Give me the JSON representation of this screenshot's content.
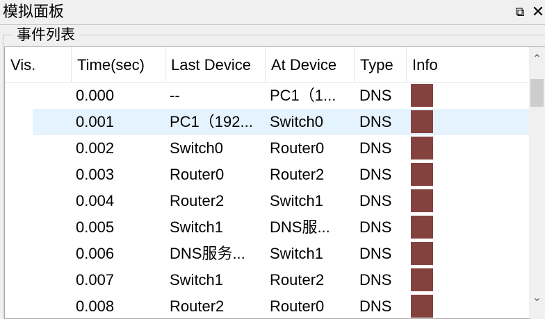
{
  "window": {
    "title": "模拟面板",
    "float_icon": "⧉",
    "close_icon": "✕"
  },
  "group": {
    "label": "事件列表"
  },
  "table": {
    "columns": [
      "Vis.",
      "Time(sec)",
      "Last Device",
      "At Device",
      "Type",
      "Info"
    ],
    "rows": [
      {
        "time": "0.000",
        "last": "--",
        "at": "PC1（1...",
        "type": "DNS",
        "info_color": "#84423f"
      },
      {
        "time": "0.001",
        "last": "PC1（192...",
        "at": "Switch0",
        "type": "DNS",
        "info_color": "#84423f"
      },
      {
        "time": "0.002",
        "last": "Switch0",
        "at": "Router0",
        "type": "DNS",
        "info_color": "#84423f"
      },
      {
        "time": "0.003",
        "last": "Router0",
        "at": "Router2",
        "type": "DNS",
        "info_color": "#84423f"
      },
      {
        "time": "0.004",
        "last": "Router2",
        "at": "Switch1",
        "type": "DNS",
        "info_color": "#84423f"
      },
      {
        "time": "0.005",
        "last": "Switch1",
        "at": "DNS服...",
        "type": "DNS",
        "info_color": "#84423f"
      },
      {
        "time": "0.006",
        "last": "DNS服务...",
        "at": "Switch1",
        "type": "DNS",
        "info_color": "#84423f"
      },
      {
        "time": "0.007",
        "last": "Switch1",
        "at": "Router2",
        "type": "DNS",
        "info_color": "#84423f"
      },
      {
        "time": "0.008",
        "last": "Router2",
        "at": "Router0",
        "type": "DNS",
        "info_color": "#84423f"
      }
    ],
    "selected_row": 1
  },
  "scrollbar": {
    "up_icon": "⌃",
    "down_icon": "⌄"
  }
}
